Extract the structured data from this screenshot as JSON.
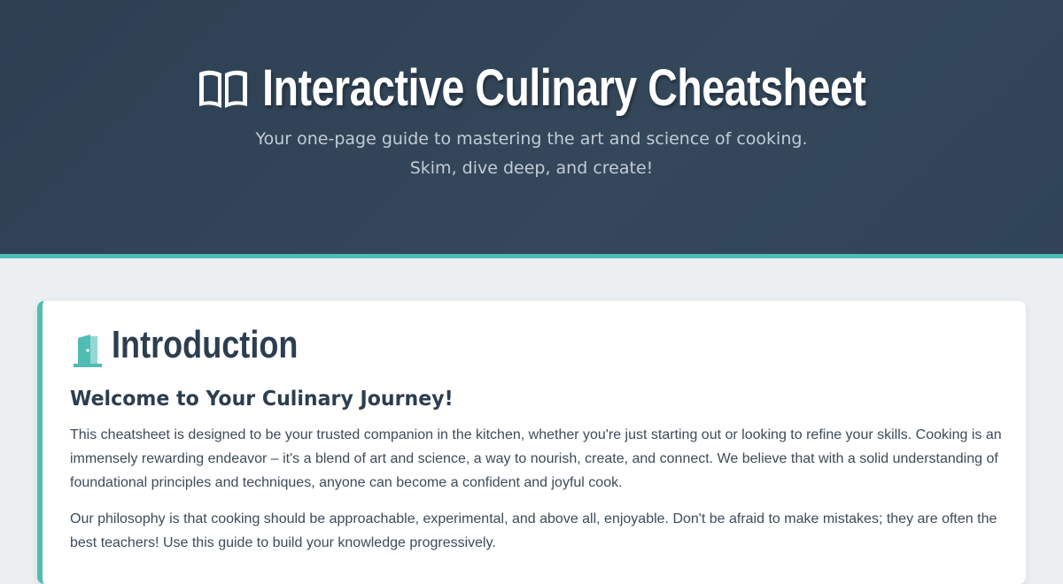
{
  "hero": {
    "title": "Interactive Culinary Cheatsheet",
    "subtitle_line1": "Your one-page guide to mastering the art and science of cooking.",
    "subtitle_line2": "Skim, dive deep, and create!",
    "icon": "open-book-icon",
    "background_color": "#304256",
    "accent_color": "#4fbdb4"
  },
  "intro": {
    "icon": "door-icon",
    "title": "Introduction",
    "subtitle": "Welcome to Your Culinary Journey!",
    "paragraphs": [
      "This cheatsheet is designed to be your trusted companion in the kitchen, whether you're just starting out or looking to refine your skills. Cooking is an immensely rewarding endeavor – it's a blend of art and science, a way to nourish, create, and connect. We believe that with a solid understanding of foundational principles and techniques, anyone can become a confident and joyful cook.",
      "Our philosophy is that cooking should be approachable, experimental, and above all, enjoyable. Don't be afraid to make mistakes; they are often the best teachers! Use this guide to build your knowledge progressively."
    ]
  }
}
